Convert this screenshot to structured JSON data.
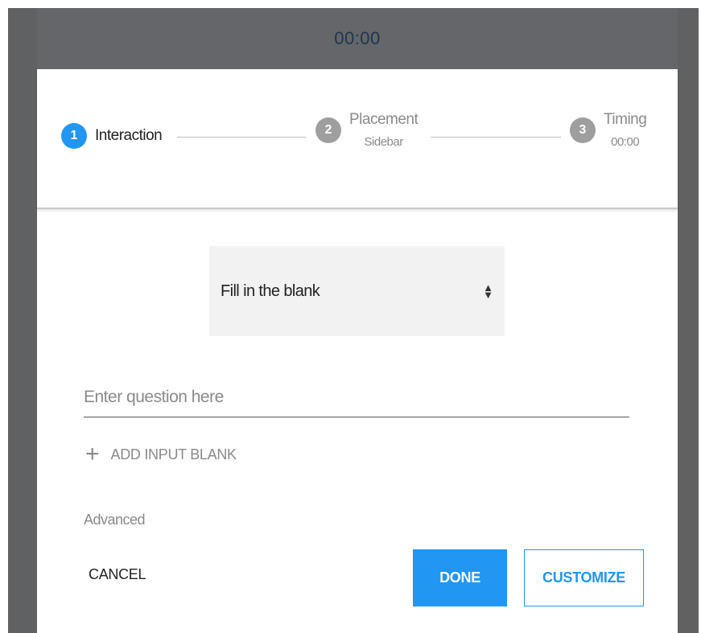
{
  "timer": {
    "display": "00:00"
  },
  "stepper": {
    "steps": [
      {
        "number": "1",
        "label": "Interaction",
        "state": "active"
      },
      {
        "number": "2",
        "label": "Placement",
        "sub": "Sidebar",
        "state": "inactive"
      },
      {
        "number": "3",
        "label": "Timing",
        "sub": "00:00",
        "state": "inactive"
      }
    ]
  },
  "interaction_type": {
    "selected": "Fill in the blank"
  },
  "question": {
    "value": "",
    "placeholder": "Enter question here"
  },
  "add_blank": {
    "icon": "plus-icon",
    "label": "ADD INPUT BLANK"
  },
  "advanced": {
    "label": "Advanced"
  },
  "actions": {
    "cancel": "CANCEL",
    "done": "DONE",
    "customize": "CUSTOMIZE"
  },
  "colors": {
    "accent": "#2196f3",
    "inactive_step": "#9e9e9e",
    "overlay": "#5f6163"
  }
}
